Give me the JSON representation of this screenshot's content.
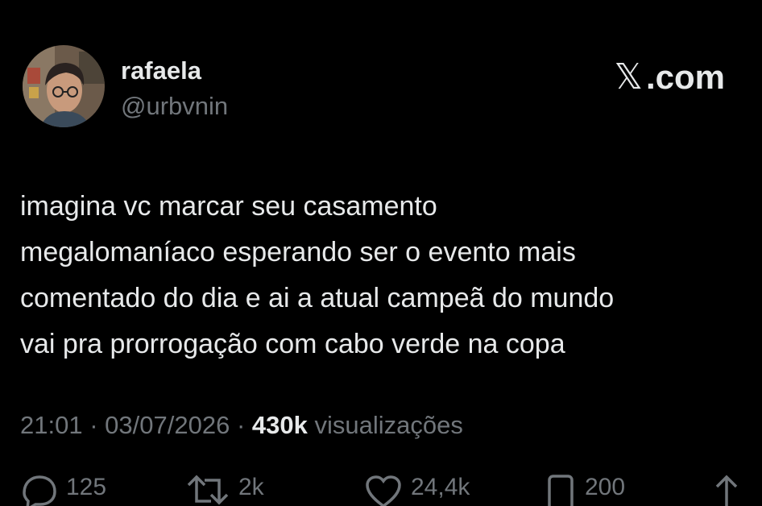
{
  "author": {
    "display_name": "rafaela",
    "handle": "@urbvnin",
    "avatar_icon": "profile-photo-avatar"
  },
  "brand": {
    "x_logo_icon": "x-logo-icon",
    "logo_glyph": "𝕏",
    "label": ".com"
  },
  "tweet": {
    "lines": [
      "imagina vc marcar seu casamento",
      "megalomaníaco esperando ser o evento mais",
      "comentado do dia e ai a atual campeã do mundo",
      "vai pra prorrogação com cabo verde na copa"
    ]
  },
  "meta": {
    "time": "21:01",
    "separator": "·",
    "date": "03/07/2026",
    "views_count": "430k",
    "views_label": "visualizações"
  },
  "actions": {
    "reply": {
      "icon": "reply-icon",
      "count": "125"
    },
    "retweet": {
      "icon": "retweet-icon",
      "count": "2k"
    },
    "like": {
      "icon": "heart-icon",
      "count": "24,4k"
    },
    "bookmark": {
      "icon": "bookmark-icon",
      "count": "200"
    },
    "share": {
      "icon": "share-icon"
    }
  },
  "colors": {
    "background": "#000000",
    "primary_text": "#e7e9ea",
    "secondary_text": "#71767b"
  }
}
